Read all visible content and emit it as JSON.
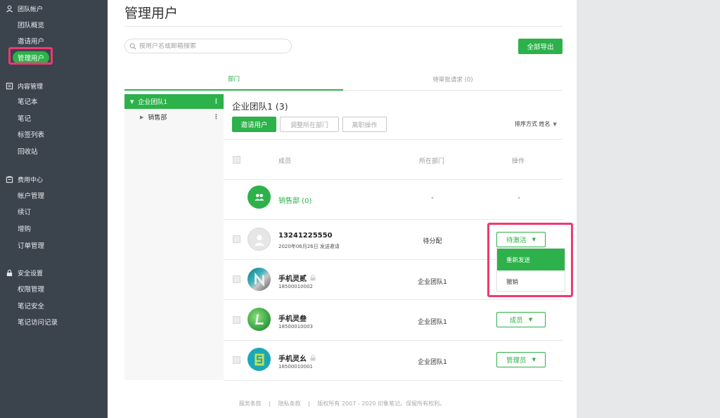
{
  "sidebar": {
    "sections": [
      {
        "title": "团队帐户",
        "icon": "user-icon",
        "items": [
          "团队概览",
          "邀请用户",
          "管理用户"
        ]
      },
      {
        "title": "内容管理",
        "icon": "notebook-icon",
        "items": [
          "笔记本",
          "笔记",
          "标签列表",
          "回收站"
        ]
      },
      {
        "title": "费用中心",
        "icon": "billing-icon",
        "items": [
          "帐户管理",
          "续订",
          "增购",
          "订单管理"
        ]
      },
      {
        "title": "安全设置",
        "icon": "lock-icon",
        "items": [
          "权限管理",
          "笔记安全",
          "笔记访问记录"
        ]
      }
    ],
    "active_item": "管理用户"
  },
  "main": {
    "title": "管理用户",
    "search_placeholder": "按用户名或邮箱搜索",
    "export_label": "全部导出",
    "tabs": [
      "部门",
      "待审批请求 (0)"
    ],
    "tree": {
      "root": "企业团队1",
      "child": "销售部"
    },
    "team_title": "企业团队1 (3)",
    "actions": [
      "邀请用户",
      "调整所在部门",
      "离职操作"
    ],
    "sort_label": "排序方式 姓名",
    "columns": {
      "member": "成员",
      "department": "所在部门",
      "operation": "操作"
    },
    "dept_row": {
      "name": "销售部 (0)",
      "department": "-",
      "operation": "-"
    },
    "users": [
      {
        "name": "13241225550",
        "sub": "2020年06月26日 发送邀请",
        "department": "待分配",
        "role": "待激活",
        "locked": false
      },
      {
        "name": "手机灵贰",
        "sub": "18500010002",
        "department": "企业团队1",
        "role": "",
        "locked": true
      },
      {
        "name": "手机灵叁",
        "sub": "18500010003",
        "department": "企业团队1",
        "role": "成员",
        "locked": false
      },
      {
        "name": "手机灵幺",
        "sub": "18500010001",
        "department": "企业团队1",
        "role": "管理员",
        "locked": true
      }
    ],
    "dropdown": [
      "重新发送",
      "撤销"
    ],
    "footer": [
      "服务条款",
      "|",
      "隐私条款",
      "|",
      "版权所有 2007 - 2020 印象笔记。保留所有权利。"
    ]
  },
  "colors": {
    "accent": "#2db14a",
    "sidebar_bg": "#3b434d",
    "highlight": "#f2386e"
  }
}
